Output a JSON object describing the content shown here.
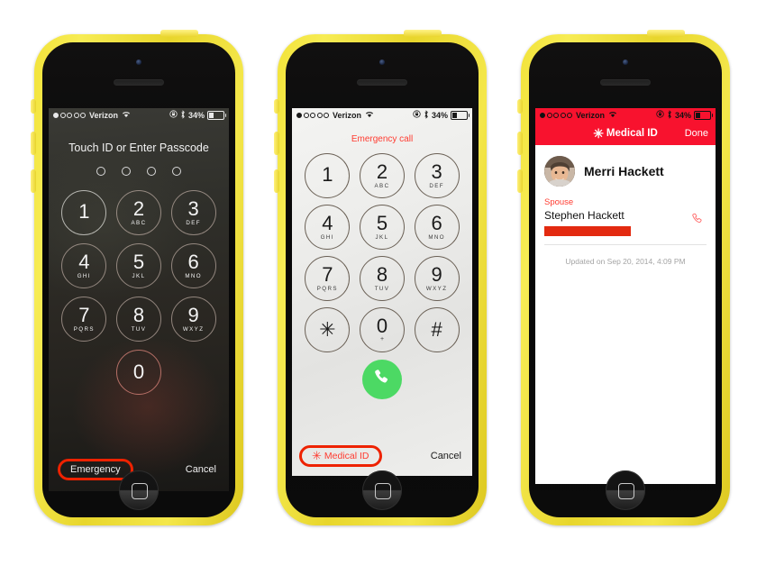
{
  "status_bar": {
    "carrier": "Verizon",
    "signal_dots_filled": 1,
    "signal_dots_total": 5,
    "wifi_icon": "wifi-icon",
    "rotation_lock_icon": "rotation-lock-icon",
    "bluetooth_icon": "bluetooth-icon",
    "battery_percent": "34%",
    "battery_level": 34
  },
  "keypad": [
    {
      "num": "1",
      "letters": ""
    },
    {
      "num": "2",
      "letters": "ABC"
    },
    {
      "num": "3",
      "letters": "DEF"
    },
    {
      "num": "4",
      "letters": "GHI"
    },
    {
      "num": "5",
      "letters": "JKL"
    },
    {
      "num": "6",
      "letters": "MNO"
    },
    {
      "num": "7",
      "letters": "PQRS"
    },
    {
      "num": "8",
      "letters": "TUV"
    },
    {
      "num": "9",
      "letters": "WXYZ"
    }
  ],
  "phone1": {
    "title": "Touch ID or Enter Passcode",
    "passcode_pips": 4,
    "zero_key": "0",
    "emergency_label": "Emergency",
    "cancel_label": "Cancel",
    "highlight_color": "#ee2200"
  },
  "phone2": {
    "header": "Emergency call",
    "star_key": "✳",
    "zero_key": "0",
    "zero_sub": "+",
    "hash_key": "#",
    "call_icon": "call-icon",
    "medical_id_label": "Medical ID",
    "medical_star": "✳",
    "cancel_label": "Cancel",
    "call_button_color": "#4cd964",
    "accent_color": "#ff3b30"
  },
  "phone3": {
    "nav_star": "✳",
    "nav_title": "Medical ID",
    "done_label": "Done",
    "person_name": "Merri Hackett",
    "avatar_icon": "avatar-photo",
    "contact_label": "Spouse",
    "contact_name": "Stephen Hackett",
    "redacted_field": "",
    "call_icon": "phone-handset-icon",
    "updated_text": "Updated on Sep 20, 2014, 4:09 PM",
    "navbar_color": "#f8122e",
    "redaction_color": "#e32a10"
  }
}
